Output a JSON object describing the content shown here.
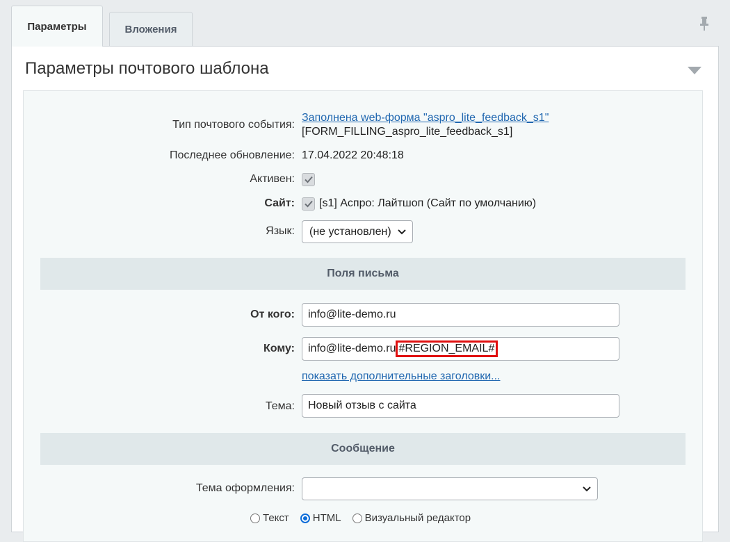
{
  "tabs": [
    {
      "label": "Параметры",
      "active": true
    },
    {
      "label": "Вложения",
      "active": false
    }
  ],
  "panel": {
    "title": "Параметры почтового шаблона"
  },
  "form": {
    "event_type": {
      "label": "Тип почтового события:",
      "link": "Заполнена web-форма \"aspro_lite_feedback_s1\"",
      "code": "[FORM_FILLING_aspro_lite_feedback_s1]"
    },
    "last_update": {
      "label": "Последнее обновление:",
      "value": "17.04.2022 20:48:18"
    },
    "active": {
      "label": "Активен:",
      "checked": true
    },
    "site": {
      "label": "Сайт:",
      "checked": true,
      "value": "[s1] Аспро: Лайтшоп (Сайт по умолчанию)"
    },
    "language": {
      "label": "Язык:",
      "selected": "(не установлен)"
    }
  },
  "letter_section": {
    "title": "Поля письма",
    "from": {
      "label": "От кого:",
      "value": "info@lite-demo.ru"
    },
    "to": {
      "label": "Кому:",
      "value": "info@lite-demo.ru",
      "highlight": "#REGION_EMAIL#"
    },
    "more_headers": "показать дополнительные заголовки...",
    "subject": {
      "label": "Тема:",
      "value": "Новый отзыв с сайта"
    }
  },
  "message_section": {
    "title": "Сообщение",
    "theme": {
      "label": "Тема оформления:",
      "selected": ""
    },
    "format_options": [
      "Текст",
      "HTML",
      "Визуальный редактор"
    ],
    "format_selected": "HTML"
  },
  "colors": {
    "accent_link": "#2067b0",
    "highlight_border": "#e01010",
    "radio_selected": "#0b6cd8"
  }
}
